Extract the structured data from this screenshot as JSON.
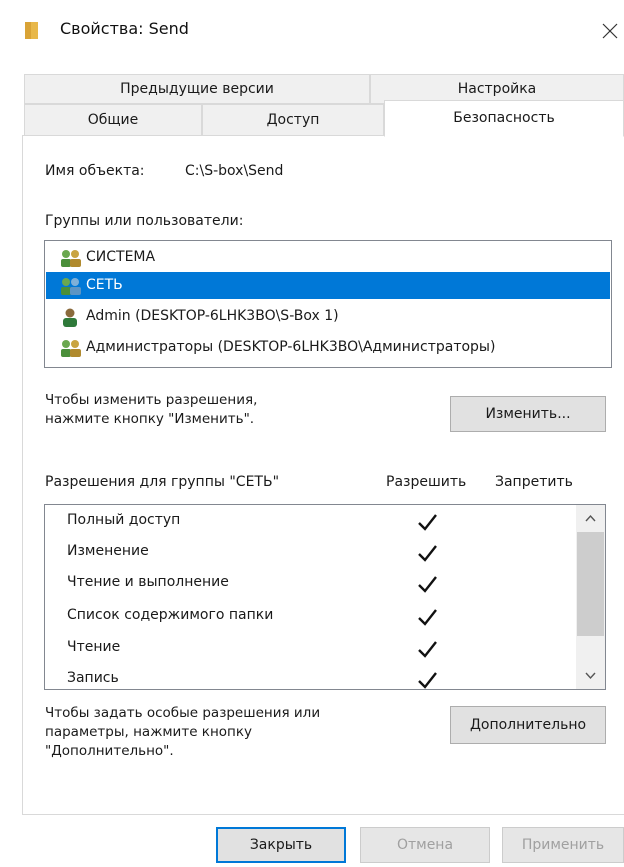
{
  "window": {
    "title": "Свойства: Send",
    "close_glyph": "✕",
    "title_icon": "folder-icon"
  },
  "tabs": {
    "row_back": [
      {
        "label": "Предыдущие версии"
      },
      {
        "label": "Настройка"
      }
    ],
    "row_front": [
      {
        "label": "Общие"
      },
      {
        "label": "Доступ"
      },
      {
        "label": "Безопасность"
      }
    ],
    "active": "Безопасность"
  },
  "security": {
    "object_label": "Имя объекта:",
    "object_path": "C:\\S-box\\Send",
    "groups_label": "Группы или пользователи:",
    "groups": [
      {
        "name": "СИСТЕМА",
        "icon": "group-icon",
        "selected": false
      },
      {
        "name": "СЕТЬ",
        "icon": "group-icon",
        "selected": true
      },
      {
        "name": "Admin (DESKTOP-6LHK3BO\\S-Box 1)",
        "icon": "user-icon",
        "selected": false
      },
      {
        "name": "Администраторы (DESKTOP-6LHK3BO\\Администраторы)",
        "icon": "group-icon",
        "selected": false
      }
    ],
    "change_hint_line1": "Чтобы изменить разрешения,",
    "change_hint_line2": "нажмите кнопку \"Изменить\".",
    "change_button": "Изменить...",
    "permissions_header": "Разрешения для группы \"СЕТЬ\"",
    "allow_header": "Разрешить",
    "deny_header": "Запретить",
    "permissions": [
      {
        "name": "Полный доступ",
        "allow": true,
        "deny": false
      },
      {
        "name": "Изменение",
        "allow": true,
        "deny": false
      },
      {
        "name": "Чтение и выполнение",
        "allow": true,
        "deny": false
      },
      {
        "name": "Список содержимого папки",
        "allow": true,
        "deny": false
      },
      {
        "name": "Чтение",
        "allow": true,
        "deny": false
      },
      {
        "name": "Запись",
        "allow": true,
        "deny": false
      }
    ],
    "advanced_hint_line1": "Чтобы задать особые разрешения или",
    "advanced_hint_line2": "параметры, нажмите кнопку",
    "advanced_hint_line3": "\"Дополнительно\".",
    "advanced_button": "Дополнительно"
  },
  "footer": {
    "close_button": "Закрыть",
    "cancel_button": "Отмена",
    "apply_button": "Применить"
  },
  "colors": {
    "selection": "#0078d7",
    "folder": "#e8b84a",
    "group_icon": "#4a8f3a",
    "user_icon": "#2f7a3a"
  }
}
